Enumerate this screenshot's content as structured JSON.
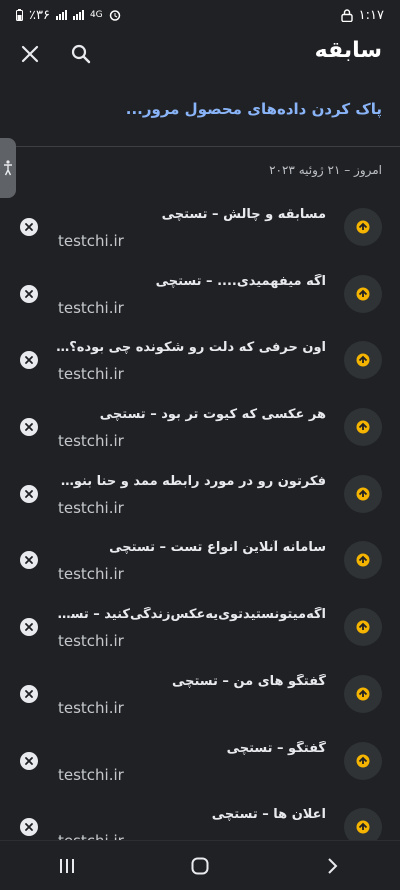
{
  "status_bar": {
    "time": "۱:۱۷",
    "battery": "٪۳۶",
    "network": "4G"
  },
  "header": {
    "title": "سابقه",
    "close_icon": "close-icon",
    "search_icon": "search-icon"
  },
  "clear_link": "پاک کردن داده‌های محصول مرور...",
  "date_header": "امروز – ۲۱ ژوئیه ۲۰۲۳",
  "items": [
    {
      "title": "مسابقه و چالش – تستچی",
      "url": "testchi.ir"
    },
    {
      "title": "اگه میفهمیدی.... – تستچی",
      "url": "testchi.ir"
    },
    {
      "title": "اون حرفی که دلت رو شکونده چی بوده؟ – ت...",
      "url": "testchi.ir"
    },
    {
      "title": "هر عکسی که کیوت تر بود – تستچی",
      "url": "testchi.ir"
    },
    {
      "title": "فکرتون رو در مورد رابطه ممد و حنا بنویسید ...",
      "url": "testchi.ir"
    },
    {
      "title": "سامانه آنلاین انواع تست – تستچی",
      "url": "testchi.ir"
    },
    {
      "title": "اگه‌میتونستیدتوی‌یه‌عکس‌زندگی‌کنید – تستچی",
      "url": "testchi.ir"
    },
    {
      "title": "گفتگو های من – تستچی",
      "url": "testchi.ir"
    },
    {
      "title": "گفتگو – تستچی",
      "url": "testchi.ir"
    },
    {
      "title": "اعلان ها – تستچی",
      "url": "testchi.ir"
    }
  ],
  "colors": {
    "background": "#202124",
    "link": "#8ab4f8",
    "favicon_accent": "#f4b400"
  }
}
